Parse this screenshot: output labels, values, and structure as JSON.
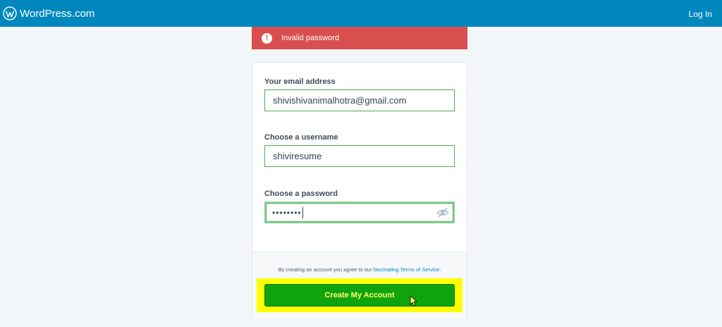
{
  "header": {
    "brand": "WordPress.com",
    "login_label": "Log In"
  },
  "notice": {
    "icon_glyph": "!",
    "message": "Invalid password"
  },
  "form": {
    "email": {
      "label": "Your email address",
      "value": "shivishivanimalhotra@gmail.com"
    },
    "username": {
      "label": "Choose a username",
      "value": "shiviresume"
    },
    "password": {
      "label": "Choose a password",
      "masked_value": "••••••••"
    }
  },
  "footer": {
    "terms_prefix": "By creating an account you agree to our ",
    "terms_link": "fascinating Terms of Service",
    "terms_suffix": ".",
    "submit_label": "Create My Account"
  },
  "colors": {
    "topbar": "#0087be",
    "error": "#d94f4f",
    "button": "#0fa30f",
    "highlight": "#ffff00",
    "valid_border": "#4caf50"
  }
}
